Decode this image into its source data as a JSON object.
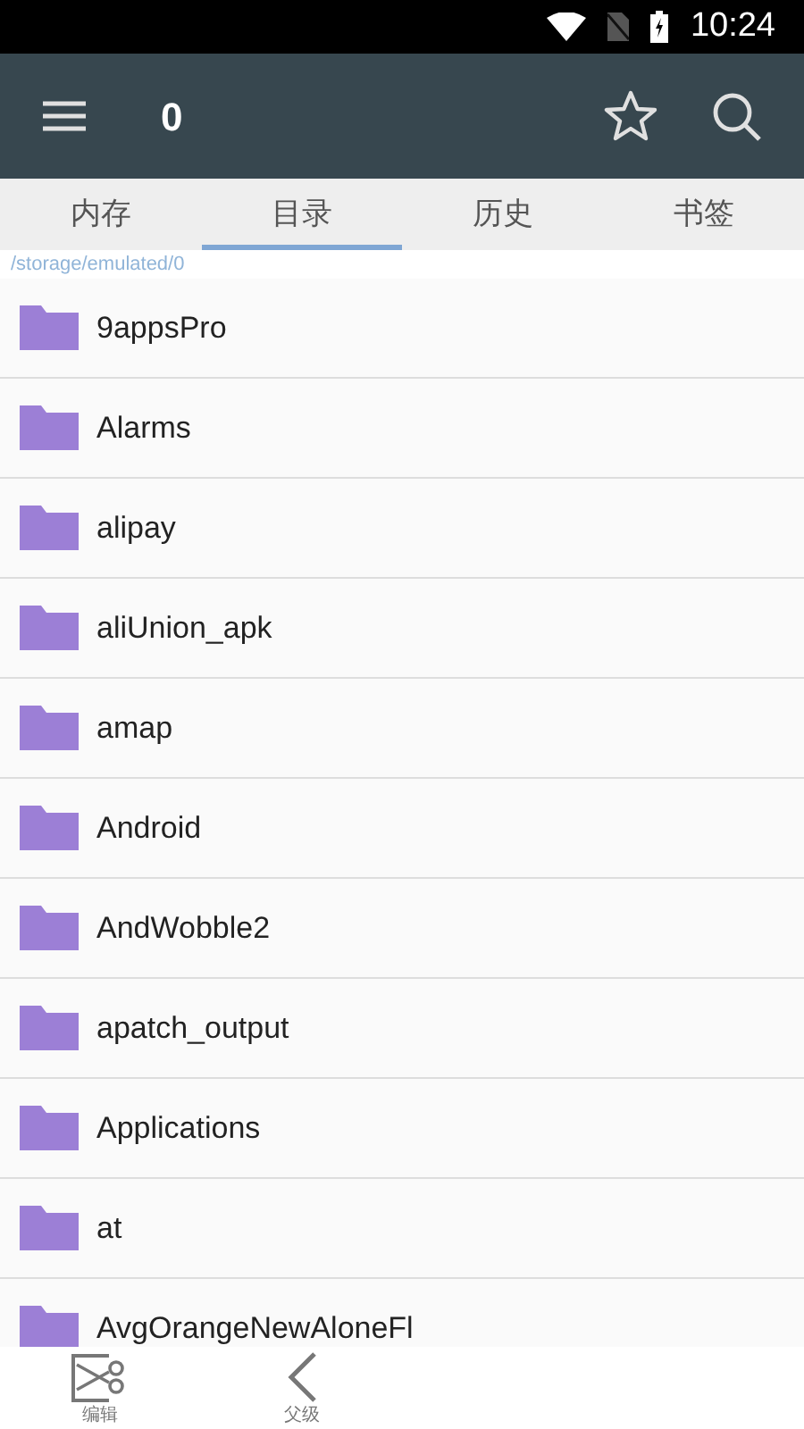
{
  "status_bar": {
    "time": "10:24"
  },
  "toolbar": {
    "title": "0"
  },
  "tabs": [
    {
      "label": "内存",
      "selected": false
    },
    {
      "label": "目录",
      "selected": true
    },
    {
      "label": "历史",
      "selected": false
    },
    {
      "label": "书签",
      "selected": false
    }
  ],
  "path": "/storage/emulated/0",
  "folders": [
    "9appsPro",
    "Alarms",
    "alipay",
    "aliUnion_apk",
    "amap",
    "Android",
    "AndWobble2",
    "apatch_output",
    "Applications",
    "at",
    "AvgOrangeNewAloneFl"
  ],
  "bottom_bar": [
    {
      "kind": "edit",
      "label": "编辑"
    },
    {
      "kind": "parent",
      "label": "父级"
    }
  ]
}
